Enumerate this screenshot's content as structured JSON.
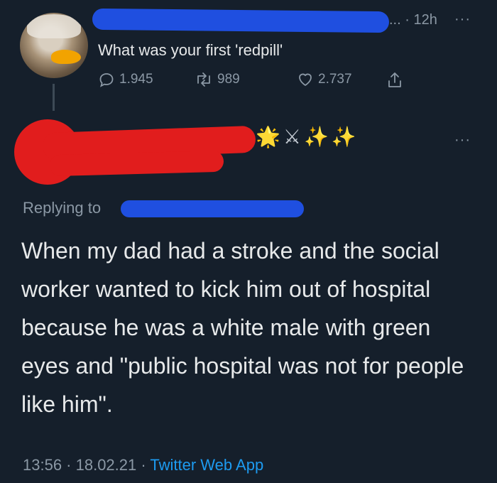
{
  "top_tweet": {
    "time_suffix": "... · 12h",
    "more": "···",
    "text": "What was your first 'redpill'",
    "replies": "1.945",
    "retweets": "989",
    "likes": "2.737"
  },
  "reply_tweet": {
    "emoji_sparkle_star": "🌟",
    "emoji_swords": "⚔",
    "emoji_sparkles": "✨",
    "more": "···",
    "replying_to": "Replying to",
    "body": "When my dad had a stroke and the social worker wanted to kick him out of hospital because he was a white male with green eyes and \"public hospital was not for people like him\".",
    "timestamp": "13:56 · 18.02.21 · ",
    "source": "Twitter Web App"
  },
  "colors": {
    "background": "#151f2b",
    "text": "#e7e9ea",
    "muted": "#8b98a5",
    "link": "#1d9bf0",
    "redaction_blue": "#1f4fe0",
    "redaction_red": "#e11d1d"
  }
}
